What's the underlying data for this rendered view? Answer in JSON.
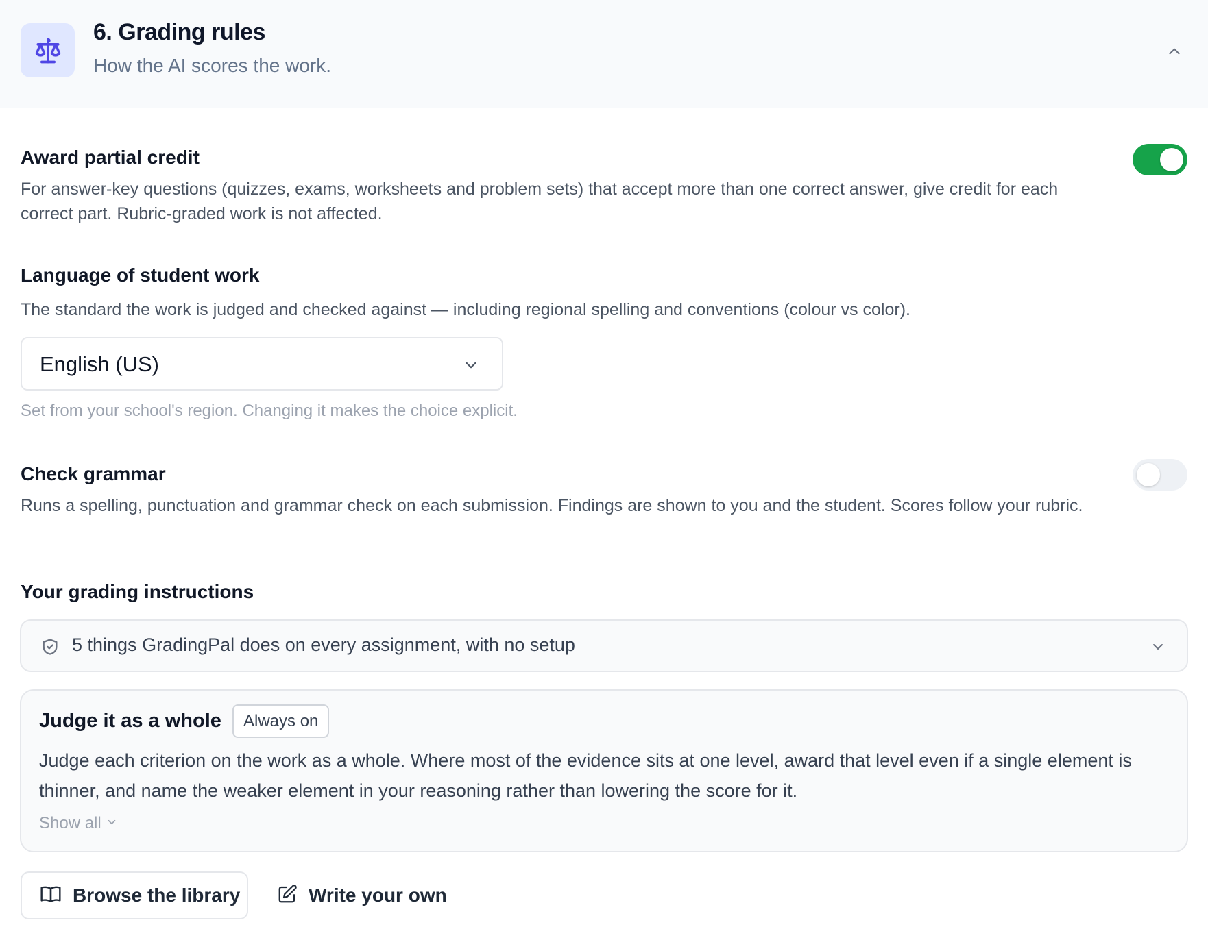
{
  "header": {
    "icon": "scale-icon",
    "title": "6. Grading rules",
    "subtitle": "How the AI scores the work.",
    "collapse_icon": "chevron-up-icon"
  },
  "partial_credit": {
    "label": "Award partial credit",
    "description": "For answer-key questions (quizzes, exams, worksheets and problem sets) that accept more than one correct answer, give credit for each correct part. Rubric-graded work is not affected.",
    "enabled": true
  },
  "language": {
    "label": "Language of student work",
    "description": "The standard the work is judged and checked against — including regional spelling and conventions (colour vs color).",
    "selected": "English (US)",
    "hint": "Set from your school's region. Changing it makes the choice explicit."
  },
  "grammar": {
    "label": "Check grammar",
    "description": "Runs a spelling, punctuation and grammar check on each submission. Findings are shown to you and the student. Scores follow your rubric.",
    "enabled": false
  },
  "instructions": {
    "label": "Your grading instructions",
    "accordion_text": "5 things GradingPal does on every assignment, with no setup",
    "accordion_icon": "shield-check-icon",
    "card": {
      "title": "Judge it as a whole",
      "badge": "Always on",
      "body": "Judge each criterion on the work as a whole. Where most of the evidence sits at one level, award that level even if a single element is thinner, and name the weaker element in your reasoning rather than lowering the score for it.",
      "show_all": "Show all"
    }
  },
  "actions": {
    "browse_label": "Browse the library",
    "browse_icon": "book-open-icon",
    "write_label": "Write your own",
    "write_icon": "pencil-square-icon"
  },
  "colors": {
    "accent": "#4f46e5",
    "toggle_on": "#16a34a",
    "header_bg": "#f8fafc"
  }
}
